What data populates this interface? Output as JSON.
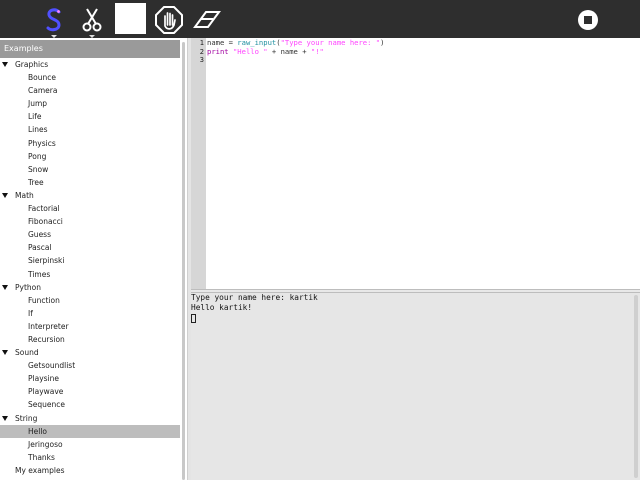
{
  "toolbar": {
    "logo_icon": "snake-logo-icon",
    "cut_icon": "scissors-icon",
    "color_swatch": "#ffffff",
    "stop_icon": "stop-hand-icon",
    "eraser_icon": "eraser-icon",
    "run_stop_icon": "stop-circle-icon",
    "colors": {
      "toolbar_bg": "#2e2e2e",
      "logo": "#4a4aff"
    }
  },
  "sidebar": {
    "title": "Examples",
    "tree": [
      {
        "type": "category",
        "label": "Graphics"
      },
      {
        "type": "leaf",
        "label": "Bounce"
      },
      {
        "type": "leaf",
        "label": "Camera"
      },
      {
        "type": "leaf",
        "label": "Jump"
      },
      {
        "type": "leaf",
        "label": "Life"
      },
      {
        "type": "leaf",
        "label": "Lines"
      },
      {
        "type": "leaf",
        "label": "Physics"
      },
      {
        "type": "leaf",
        "label": "Pong"
      },
      {
        "type": "leaf",
        "label": "Snow"
      },
      {
        "type": "leaf",
        "label": "Tree"
      },
      {
        "type": "category",
        "label": "Math"
      },
      {
        "type": "leaf",
        "label": "Factorial"
      },
      {
        "type": "leaf",
        "label": "Fibonacci"
      },
      {
        "type": "leaf",
        "label": "Guess"
      },
      {
        "type": "leaf",
        "label": "Pascal"
      },
      {
        "type": "leaf",
        "label": "Sierpinski"
      },
      {
        "type": "leaf",
        "label": "Times"
      },
      {
        "type": "category",
        "label": "Python"
      },
      {
        "type": "leaf",
        "label": "Function"
      },
      {
        "type": "leaf",
        "label": "If"
      },
      {
        "type": "leaf",
        "label": "Interpreter"
      },
      {
        "type": "leaf",
        "label": "Recursion"
      },
      {
        "type": "category",
        "label": "Sound"
      },
      {
        "type": "leaf",
        "label": "Getsoundlist"
      },
      {
        "type": "leaf",
        "label": "Playsine"
      },
      {
        "type": "leaf",
        "label": "Playwave"
      },
      {
        "type": "leaf",
        "label": "Sequence"
      },
      {
        "type": "category",
        "label": "String"
      },
      {
        "type": "leaf",
        "label": "Hello",
        "selected": true
      },
      {
        "type": "leaf",
        "label": "Jeringoso"
      },
      {
        "type": "leaf",
        "label": "Thanks"
      },
      {
        "type": "root",
        "label": "My examples"
      }
    ]
  },
  "editor": {
    "line_numbers": [
      "1",
      "2",
      "3"
    ],
    "lines": [
      [
        {
          "t": "name",
          "c": "id"
        },
        {
          "t": " = ",
          "c": "id"
        },
        {
          "t": "raw_input",
          "c": "fn"
        },
        {
          "t": "(",
          "c": "id"
        },
        {
          "t": "\"Type your name here: \"",
          "c": "str"
        },
        {
          "t": ")",
          "c": "id"
        }
      ],
      [
        {
          "t": "print",
          "c": "kw"
        },
        {
          "t": " ",
          "c": "id"
        },
        {
          "t": "\"Hello \"",
          "c": "str"
        },
        {
          "t": " + name + ",
          "c": "id"
        },
        {
          "t": "\"!\"",
          "c": "str"
        }
      ],
      []
    ]
  },
  "console": {
    "lines": [
      "Type your name here: kartik",
      "Hello kartik!"
    ]
  }
}
